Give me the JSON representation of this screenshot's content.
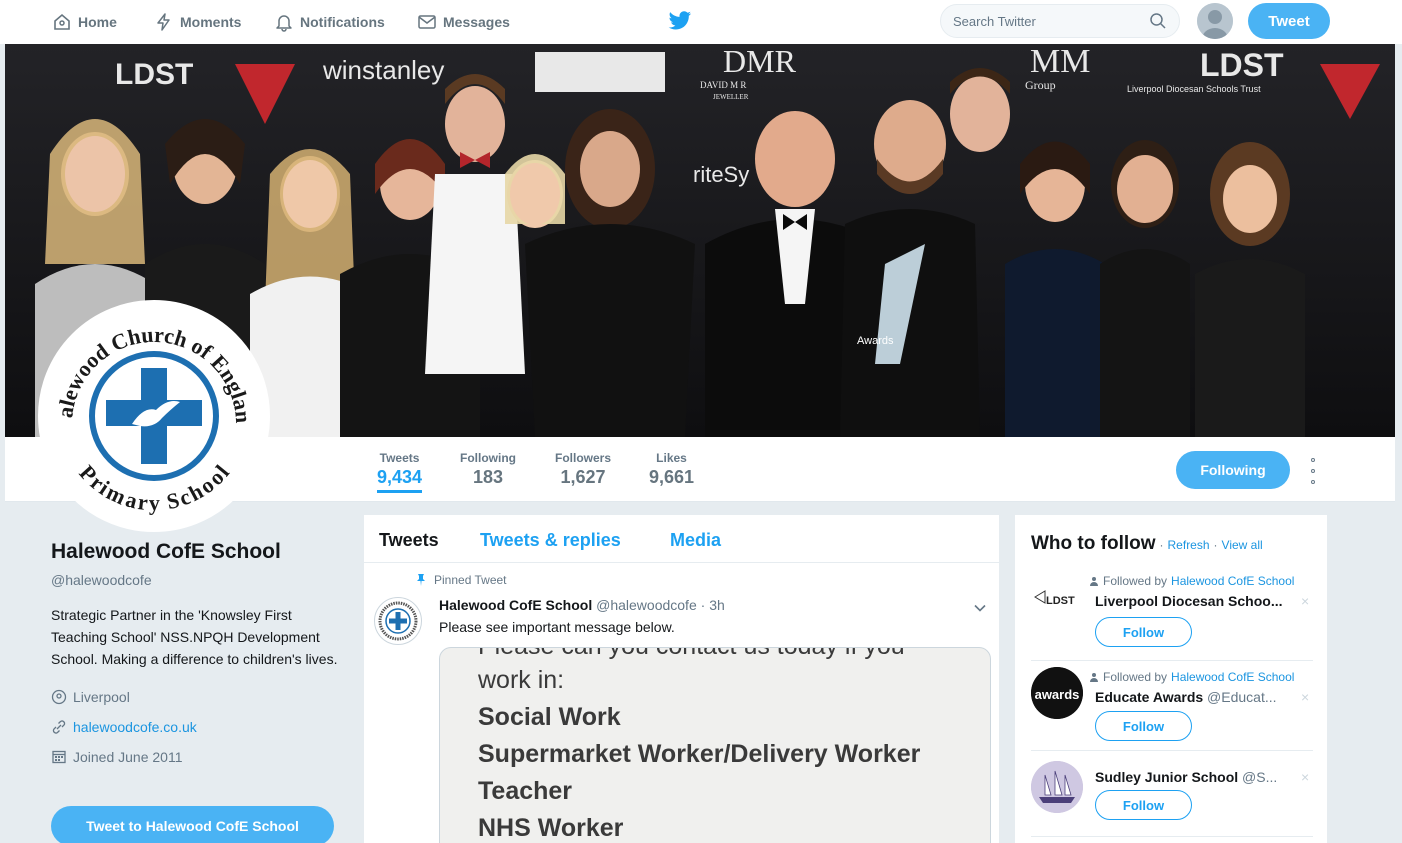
{
  "nav": {
    "home": "Home",
    "moments": "Moments",
    "notifications": "Notifications",
    "messages": "Messages",
    "search_placeholder": "Search Twitter",
    "tweet_button": "Tweet"
  },
  "banner": {
    "logo_texts": [
      "LDST",
      "winstanley",
      "DMR",
      "DAVID M R",
      "JEWELLER",
      "MM",
      "Group",
      "LDST",
      "Liverpool Diocesan Schools Trust",
      "riteSy",
      "Awards"
    ]
  },
  "avatar_logo": {
    "top_text": "Halewood Church of England",
    "bottom_text": "Primary School"
  },
  "stats": [
    {
      "label": "Tweets",
      "value": "9,434"
    },
    {
      "label": "Following",
      "value": "183"
    },
    {
      "label": "Followers",
      "value": "1,627"
    },
    {
      "label": "Likes",
      "value": "9,661"
    }
  ],
  "following_button": "Following",
  "profile": {
    "name": "Halewood CofE School",
    "handle": "@halewoodcofe",
    "bio": "Strategic Partner in the 'Knowsley First Teaching School' NSS.NPQH Development School. Making a difference to children's lives.",
    "location": "Liverpool",
    "website": "halewoodcofe.co.uk",
    "joined": "Joined June 2011",
    "tweet_to_button": "Tweet to Halewood CofE School"
  },
  "timeline": {
    "tabs": [
      "Tweets",
      "Tweets & replies",
      "Media"
    ],
    "pinned_label": "Pinned Tweet",
    "tweet": {
      "name": "Halewood CofE School",
      "handle": "@halewoodcofe",
      "time": "· 3h",
      "text": "Please see important message below.",
      "media_lines": [
        "Please can you contact us today if you",
        "work in:",
        "Social Work",
        "Supermarket Worker/Delivery Worker",
        "Teacher",
        "NHS Worker"
      ]
    }
  },
  "who_to_follow": {
    "title": "Who to follow",
    "separator": "·",
    "refresh": "Refresh",
    "view_all": "View all",
    "follow_label": "Follow",
    "close": "×",
    "items": [
      {
        "context_prefix": "Followed by",
        "context_name": "Halewood CofE School",
        "name": "Liverpool Diocesan Schoo...",
        "handle": "",
        "avatar_text": "LDST"
      },
      {
        "context_prefix": "Followed by",
        "context_name": "Halewood CofE School",
        "name": "Educate Awards",
        "handle": "@Educat...",
        "avatar_text": "awards"
      },
      {
        "context_prefix": "",
        "context_name": "",
        "name": "Sudley Junior School",
        "handle": "@S...",
        "avatar_text": ""
      }
    ]
  }
}
